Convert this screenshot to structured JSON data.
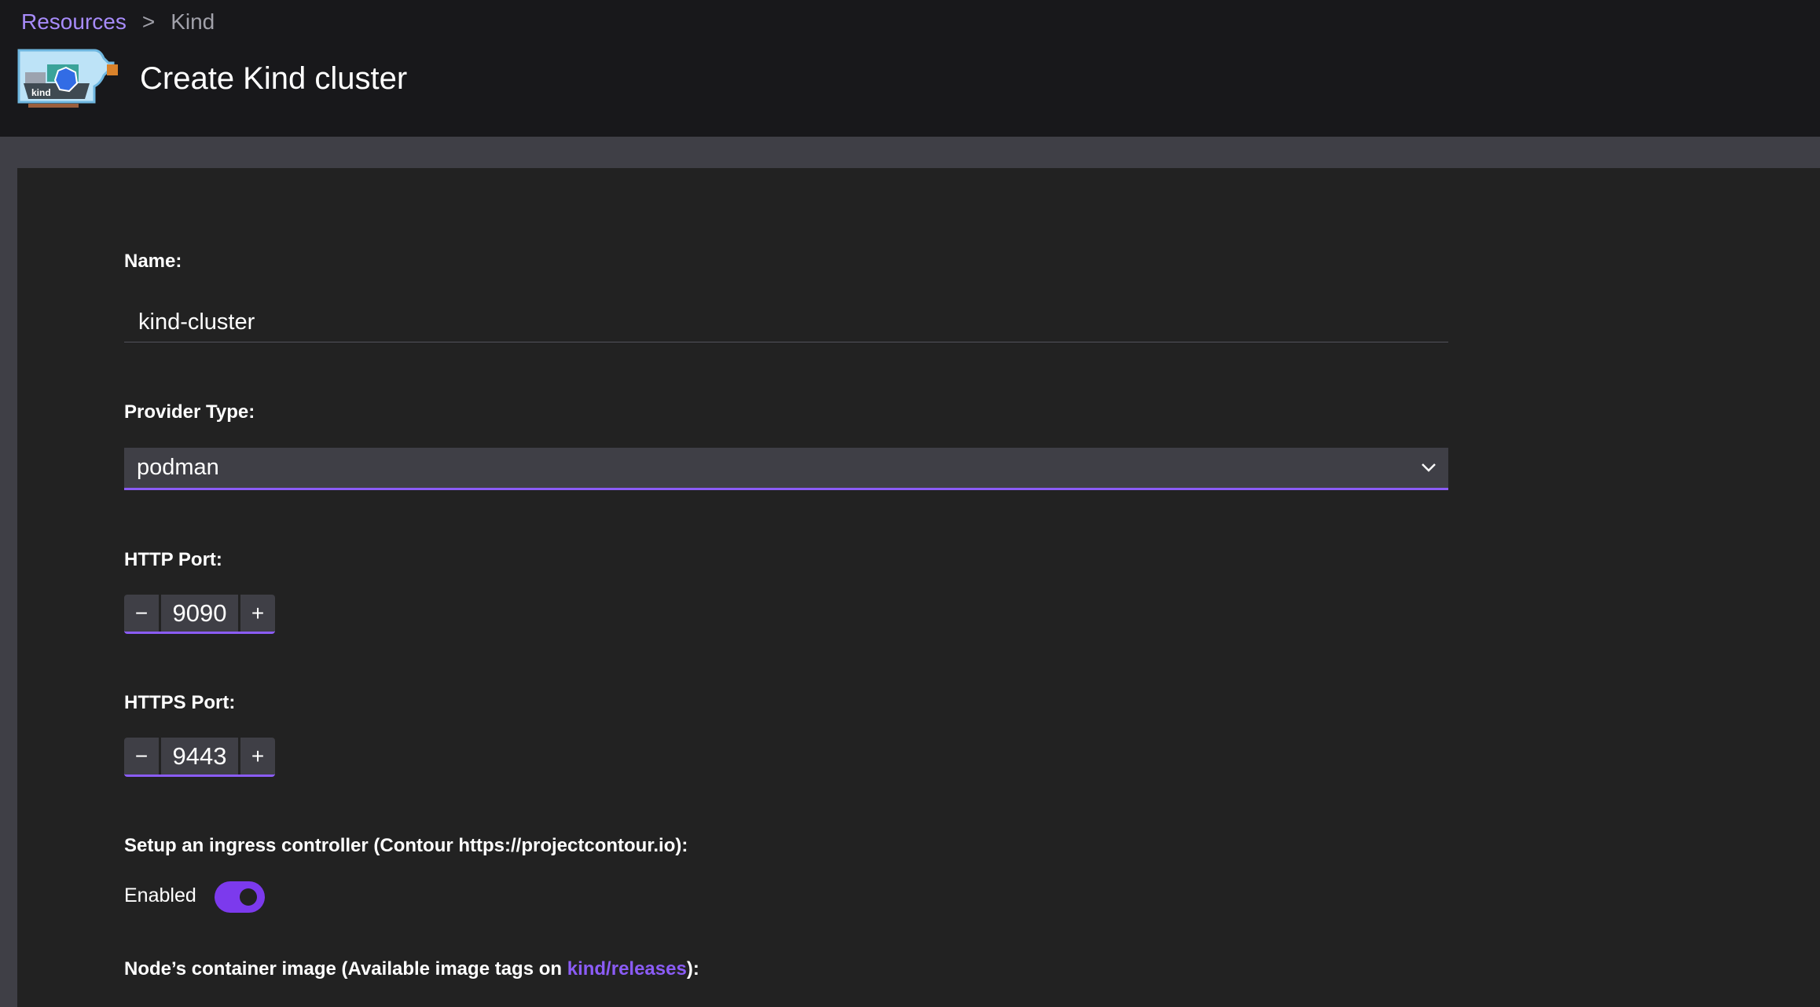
{
  "breadcrumb": {
    "parent": "Resources",
    "separator": ">",
    "current": "Kind"
  },
  "header": {
    "title": "Create Kind cluster",
    "logo_text": "kind"
  },
  "form": {
    "name": {
      "label": "Name:",
      "value": "kind-cluster"
    },
    "provider": {
      "label": "Provider Type:",
      "value": "podman"
    },
    "http_port": {
      "label": "HTTP Port:",
      "value": "9090",
      "decrement": "−",
      "increment": "+"
    },
    "https_port": {
      "label": "HTTPS Port:",
      "value": "9443",
      "decrement": "−",
      "increment": "+"
    },
    "ingress": {
      "label": "Setup an ingress controller (Contour https://projectcontour.io):",
      "toggle_label": "Enabled",
      "enabled": true
    },
    "node_image": {
      "label_prefix": "Node’s container image (Available image tags on ",
      "link": "kind/releases",
      "label_suffix": "):"
    }
  },
  "colors": {
    "accent": "#8b5cf6",
    "header_bg": "#18181b",
    "panel_bg": "#222222",
    "input_bg": "#3f3f46"
  }
}
